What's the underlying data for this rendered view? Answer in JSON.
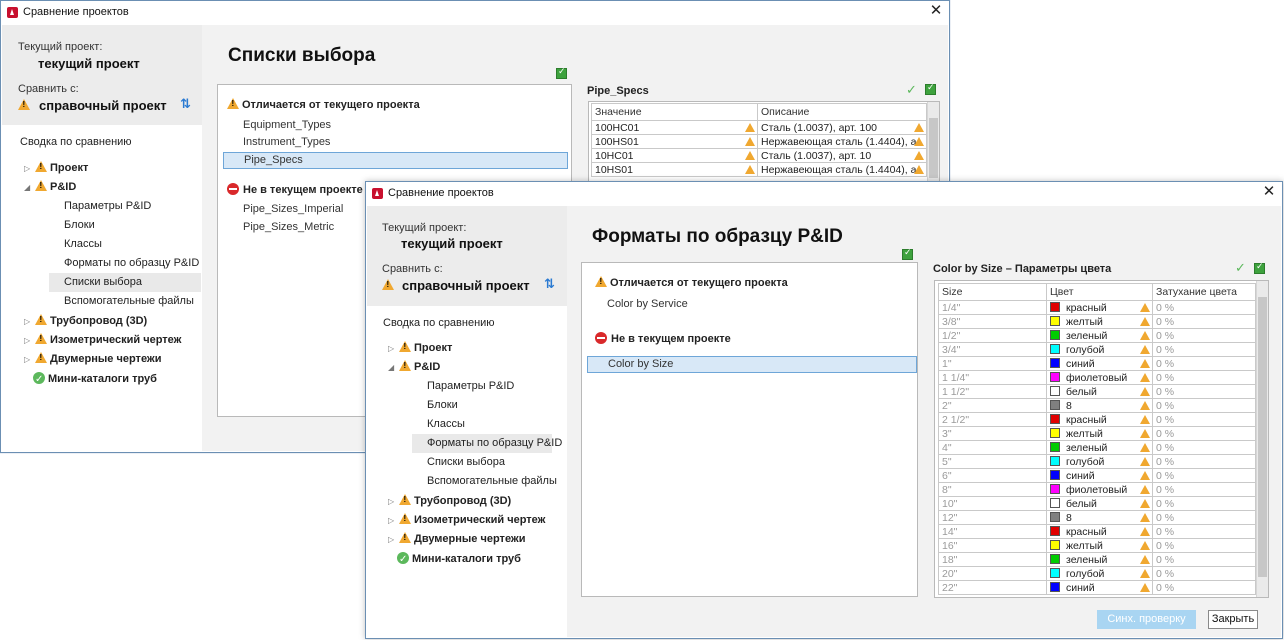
{
  "dialog_title": "Сравнение проектов",
  "labels": {
    "current_project_label": "Текущий проект:",
    "current_project_name": "текущий проект",
    "compare_with_label": "Сравнить с:",
    "reference_project_name": "справочный проект",
    "summary_title": "Сводка по сравнению",
    "differs_header": "Отличается от текущего проекта",
    "not_in_current_header": "Не в текущем проекте"
  },
  "tree": {
    "project": "Проект",
    "pid": "P&ID",
    "pid_children": [
      "Параметры P&ID",
      "Блоки",
      "Классы",
      "Форматы по образцу P&ID",
      "Списки выбора",
      "Вспомогательные файлы"
    ],
    "piping3d": "Трубопровод (3D)",
    "iso": "Изометрический чертеж",
    "ortho": "Двумерные чертежи",
    "mini": "Мини-каталоги труб"
  },
  "dialog1": {
    "title": "Списки выбора",
    "differs_items": [
      "Equipment_Types",
      "Instrument_Types",
      "Pipe_Specs"
    ],
    "not_in_current_items": [
      "Pipe_Sizes_Imperial",
      "Pipe_Sizes_Metric"
    ],
    "panel_title": "Pipe_Specs",
    "columns": [
      "Значение",
      "Описание"
    ],
    "rows": [
      [
        "100HC01",
        "Сталь (1.0037), арт. 100"
      ],
      [
        "100HS01",
        "Нержавеющая сталь (1.4404), а"
      ],
      [
        "10HC01",
        "Сталь (1.0037), арт. 10"
      ],
      [
        "10HS01",
        "Нержавеющая сталь (1.4404), а"
      ]
    ]
  },
  "dialog2": {
    "title": "Форматы по образцу P&ID",
    "differs_items": [
      "Color by Service"
    ],
    "not_in_current_items": [
      "Color by Size"
    ],
    "panel_title": "Color by Size  – Параметры цвета",
    "columns": [
      "Size",
      "Цвет",
      "Затухание цвета"
    ],
    "rows": [
      {
        "size": "1/4\"",
        "color": "красный",
        "hex": "#e00000",
        "fade": "0 %"
      },
      {
        "size": "3/8\"",
        "color": "желтый",
        "hex": "#ffff00",
        "fade": "0 %"
      },
      {
        "size": "1/2\"",
        "color": "зеленый",
        "hex": "#00cc00",
        "fade": "0 %"
      },
      {
        "size": "3/4\"",
        "color": "голубой",
        "hex": "#00ffff",
        "fade": "0 %"
      },
      {
        "size": "1\"",
        "color": "синий",
        "hex": "#0000ff",
        "fade": "0 %"
      },
      {
        "size": "1 1/4\"",
        "color": "фиолетовый",
        "hex": "#ff00ff",
        "fade": "0 %"
      },
      {
        "size": "1 1/2\"",
        "color": "белый",
        "hex": "#ffffff",
        "fade": "0 %"
      },
      {
        "size": "2\"",
        "color": "8",
        "hex": "#808080",
        "fade": "0 %"
      },
      {
        "size": "2 1/2\"",
        "color": "красный",
        "hex": "#e00000",
        "fade": "0 %"
      },
      {
        "size": "3\"",
        "color": "желтый",
        "hex": "#ffff00",
        "fade": "0 %"
      },
      {
        "size": "4\"",
        "color": "зеленый",
        "hex": "#00cc00",
        "fade": "0 %"
      },
      {
        "size": "5\"",
        "color": "голубой",
        "hex": "#00ffff",
        "fade": "0 %"
      },
      {
        "size": "6\"",
        "color": "синий",
        "hex": "#0000ff",
        "fade": "0 %"
      },
      {
        "size": "8\"",
        "color": "фиолетовый",
        "hex": "#ff00ff",
        "fade": "0 %"
      },
      {
        "size": "10\"",
        "color": "белый",
        "hex": "#ffffff",
        "fade": "0 %"
      },
      {
        "size": "12\"",
        "color": "8",
        "hex": "#808080",
        "fade": "0 %"
      },
      {
        "size": "14\"",
        "color": "красный",
        "hex": "#e00000",
        "fade": "0 %"
      },
      {
        "size": "16\"",
        "color": "желтый",
        "hex": "#ffff00",
        "fade": "0 %"
      },
      {
        "size": "18\"",
        "color": "зеленый",
        "hex": "#00cc00",
        "fade": "0 %"
      },
      {
        "size": "20\"",
        "color": "голубой",
        "hex": "#00ffff",
        "fade": "0 %"
      },
      {
        "size": "22\"",
        "color": "синий",
        "hex": "#0000ff",
        "fade": "0 %"
      }
    ]
  },
  "buttons": {
    "sync": "Синх. проверку",
    "close": "Закрыть"
  },
  "icons": [
    "app-icon",
    "close-icon",
    "warning-icon",
    "ok-icon",
    "not-in-project-icon",
    "swap-icon",
    "sync-check-icon",
    "checkmark-icon"
  ],
  "colors": {
    "warning": "#f0a830",
    "ok": "#5cb85c",
    "stop": "#d9292b",
    "selection": "#d8e8f7",
    "primary_button": "#a9d5f2"
  }
}
